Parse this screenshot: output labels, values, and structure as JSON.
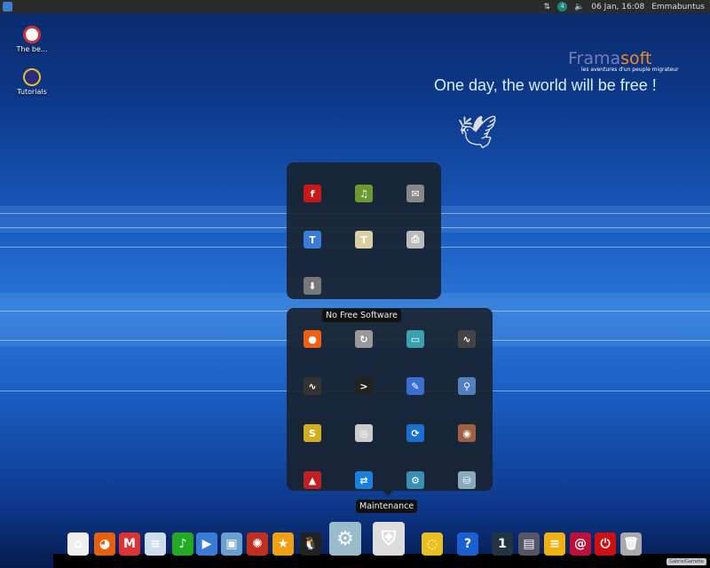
{
  "panel": {
    "date_time": "06 Jan, 16:08",
    "user": "Emmabuntus",
    "indicator": "4"
  },
  "desktop": {
    "icons": [
      {
        "label": "The be...",
        "icon": "debian-package-icon"
      },
      {
        "label": "Tutorials",
        "icon": "tutorials-icon"
      }
    ]
  },
  "wallpaper": {
    "brand_a": "Frama",
    "brand_b": "soft",
    "brand_sub": "les aventures d'un peuple migrateur",
    "slogan": "One day, the world will be free !"
  },
  "popup_top": {
    "icons": [
      {
        "name": "flash-icon",
        "color": "#c81818",
        "glyph": "f"
      },
      {
        "name": "audio-editor-icon",
        "color": "#6a9a30",
        "glyph": "♫"
      },
      {
        "name": "mail-settings-icon",
        "color": "#888",
        "glyph": "✉"
      },
      {
        "name": "font-viewer-icon",
        "color": "#3a7bd5",
        "glyph": "T"
      },
      {
        "name": "font-manager-icon",
        "color": "#d8d0a0",
        "glyph": "T"
      },
      {
        "name": "printer-icon",
        "color": "#bbb",
        "glyph": "⎙"
      },
      {
        "name": "install-software-icon",
        "color": "#777",
        "glyph": "⬇"
      }
    ]
  },
  "popup_bottom": {
    "tooltip": "No Free Software",
    "icons": [
      {
        "name": "backup-icon",
        "color": "#f06010",
        "glyph": "●"
      },
      {
        "name": "software-updater-icon",
        "color": "#999",
        "glyph": "↻"
      },
      {
        "name": "laptop-icon",
        "color": "#3aa0b0",
        "glyph": "▭"
      },
      {
        "name": "system-monitor-icon",
        "color": "#444",
        "glyph": "∿"
      },
      {
        "name": "task-manager-icon",
        "color": "#333",
        "glyph": "∿"
      },
      {
        "name": "terminal-icon",
        "color": "#222",
        "glyph": ">"
      },
      {
        "name": "cleaner-icon",
        "color": "#3a6fd0",
        "glyph": "✎"
      },
      {
        "name": "disk-analyzer-icon",
        "color": "#5080c0",
        "glyph": "⚲"
      },
      {
        "name": "system-info-icon",
        "color": "#d0b020",
        "glyph": "S"
      },
      {
        "name": "package-icon",
        "color": "#ccc",
        "glyph": "◎"
      },
      {
        "name": "sync-icon",
        "color": "#1a70d0",
        "glyph": "⟳"
      },
      {
        "name": "safe-icon",
        "color": "#a06040",
        "glyph": "◉"
      },
      {
        "name": "firewall-icon",
        "color": "#c02020",
        "glyph": "▲"
      },
      {
        "name": "teamviewer-icon",
        "color": "#1a80e0",
        "glyph": "⇄"
      },
      {
        "name": "network-tools-icon",
        "color": "#3a90b0",
        "glyph": "⚙"
      },
      {
        "name": "disk-backup-icon",
        "color": "#8ab",
        "glyph": "⛁"
      }
    ]
  },
  "dock": {
    "tooltip": "Maintenance",
    "items": [
      {
        "name": "home-icon",
        "color": "#eee",
        "glyph": "⌂"
      },
      {
        "name": "firefox-icon",
        "color": "#e66010",
        "glyph": "◕"
      },
      {
        "name": "mail-icon",
        "color": "#d33",
        "glyph": "M"
      },
      {
        "name": "office-icon",
        "color": "#cde",
        "glyph": "≡"
      },
      {
        "name": "multimedia-icon",
        "color": "#2a2",
        "glyph": "♪"
      },
      {
        "name": "video-icon",
        "color": "#3a7bd5",
        "glyph": "▶"
      },
      {
        "name": "photo-icon",
        "color": "#6aa0d0",
        "glyph": "▣"
      },
      {
        "name": "internet-icon",
        "color": "#c03020",
        "glyph": "✺"
      },
      {
        "name": "favorites-icon",
        "color": "#f0a010",
        "glyph": "★"
      },
      {
        "name": "linux-icon",
        "color": "#222",
        "glyph": "🐧"
      },
      {
        "name": "settings-icon",
        "color": "#9bc",
        "glyph": "⚙"
      },
      {
        "name": "maintenance-icon",
        "color": "#ddd",
        "glyph": "⛨"
      },
      {
        "name": "tutorials-icon",
        "color": "#e8c020",
        "glyph": "◌"
      },
      {
        "name": "help-icon",
        "color": "#1a60d0",
        "glyph": "?"
      },
      {
        "name": "workspaces-icon",
        "color": "#234",
        "glyph": "1"
      },
      {
        "name": "window-switcher-icon",
        "color": "#556",
        "glyph": "▤"
      },
      {
        "name": "notes-icon",
        "color": "#f0b010",
        "glyph": "≡"
      },
      {
        "name": "debian-icon",
        "color": "#c0103a",
        "glyph": "@"
      },
      {
        "name": "power-icon",
        "color": "#d01010",
        "glyph": "⏻"
      },
      {
        "name": "trash-icon",
        "color": "#aaa",
        "glyph": "🗑"
      }
    ]
  },
  "signature": "GabrielGarrette"
}
